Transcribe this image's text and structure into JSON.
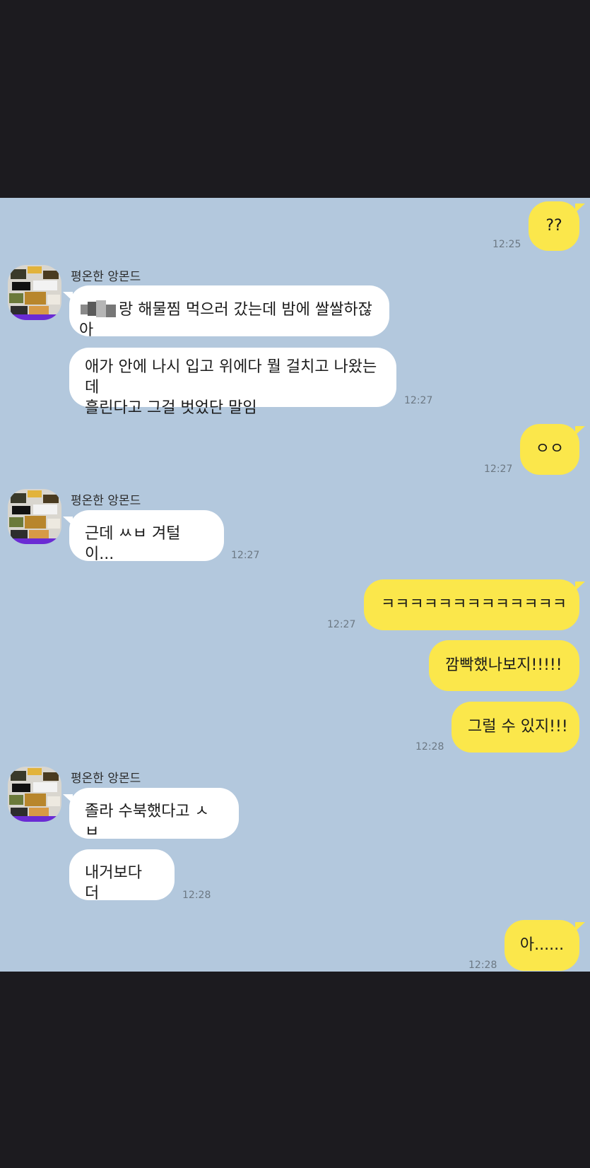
{
  "chat": {
    "background": "#b3c8dd",
    "friend_name": "평온한 앙몬드",
    "messages": {
      "m1": {
        "text": "??",
        "time": "12:25"
      },
      "m2": {
        "text": "랑 해물찜 먹으러 갔는데 밤에 쌀쌀하잖아"
      },
      "m3": {
        "line1": "애가 안에 나시 입고 위에다 뭘 걸치고 나왔는데",
        "line2": "흘린다고 그걸 벗었단 말임",
        "time": "12:27"
      },
      "m4": {
        "text": "ㅇㅇ",
        "time": "12:27"
      },
      "m5": {
        "text": "근데 ㅆㅂ 겨털이...",
        "time": "12:27"
      },
      "m6": {
        "text": "ㅋㅋㅋㅋㅋㅋㅋㅋㅋㅋㅋㅋㅋ",
        "time": "12:27"
      },
      "m7": {
        "text": "깜빡했나보지!!!!!"
      },
      "m8": {
        "text": "그럴 수 있지!!!",
        "time": "12:28"
      },
      "m9": {
        "text": "졸라 수북했다고 ㅅㅂ"
      },
      "m10": {
        "text": "내거보다 더",
        "time": "12:28"
      },
      "m11": {
        "text": "아......",
        "time": "12:28"
      }
    }
  },
  "colors": {
    "outgoing_bubble": "#fbe74b",
    "incoming_bubble": "#ffffff",
    "letterbox": "#1c1b1f"
  },
  "icons": {
    "avatar": "friend-avatar",
    "sticker": "inline-sticker-image"
  }
}
